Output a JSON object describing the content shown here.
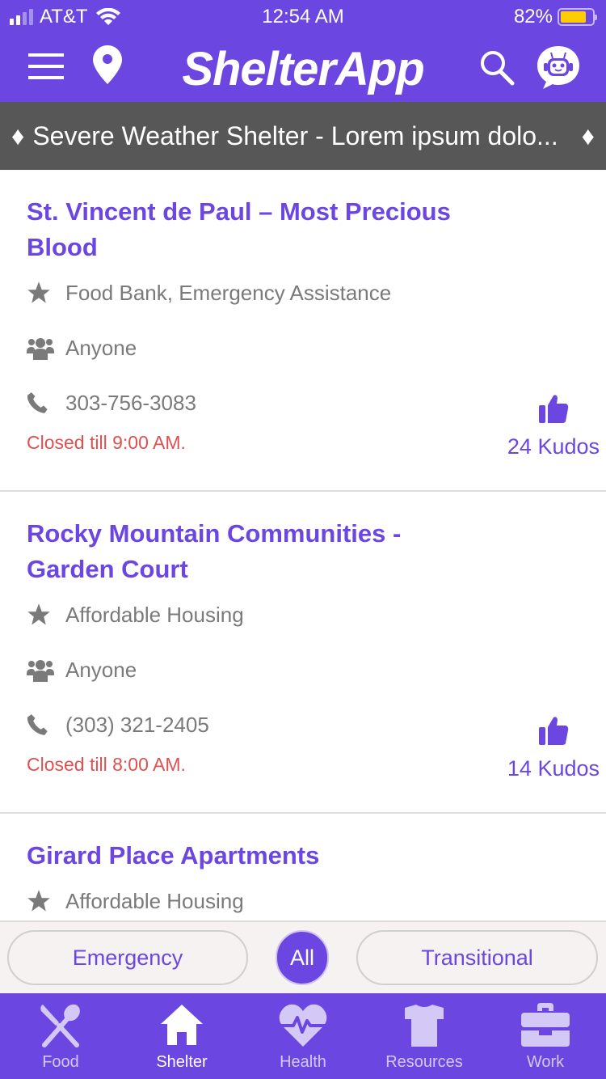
{
  "status_bar": {
    "carrier": "AT&T",
    "time": "12:54 AM",
    "battery_text": "82%",
    "battery_level": 0.82
  },
  "header": {
    "title": "ShelterApp",
    "icons": [
      "menu-icon",
      "location-pin-icon",
      "search-icon",
      "chatbot-icon"
    ]
  },
  "banner": {
    "text": "Severe Weather Shelter - Lorem ipsum dolo...",
    "left_icon": "diamond-icon",
    "right_icon": "diamond-icon"
  },
  "listings": [
    {
      "title": "St. Vincent de Paul – Most Precious Blood",
      "category": "Food Bank, Emergency Assistance",
      "audience": "Anyone",
      "phone": "303-756-3083",
      "status": "Closed till 9:00 AM.",
      "kudos": "24 Kudos"
    },
    {
      "title": "Rocky Mountain Communities - Garden Court",
      "category": "Affordable Housing",
      "audience": "Anyone",
      "phone": "(303) 321-2405",
      "status": "Closed till 8:00 AM.",
      "kudos": "14 Kudos"
    },
    {
      "title": "Girard Place Apartments",
      "category": "Affordable Housing"
    }
  ],
  "filters": {
    "items": [
      "Emergency",
      "All",
      "Transitional"
    ],
    "selected": "All"
  },
  "tab_bar": {
    "items": [
      {
        "label": "Food",
        "icon": "utensils-icon"
      },
      {
        "label": "Shelter",
        "icon": "home-icon"
      },
      {
        "label": "Health",
        "icon": "heartbeat-icon"
      },
      {
        "label": "Resources",
        "icon": "tshirt-icon"
      },
      {
        "label": "Work",
        "icon": "briefcase-icon"
      }
    ],
    "active": "Shelter"
  },
  "colors": {
    "brand": "#6b46e1",
    "banner_bg": "#575757",
    "closed_status": "#e05050",
    "muted_text": "#7a7a7a",
    "battery": "#ffcc00"
  }
}
